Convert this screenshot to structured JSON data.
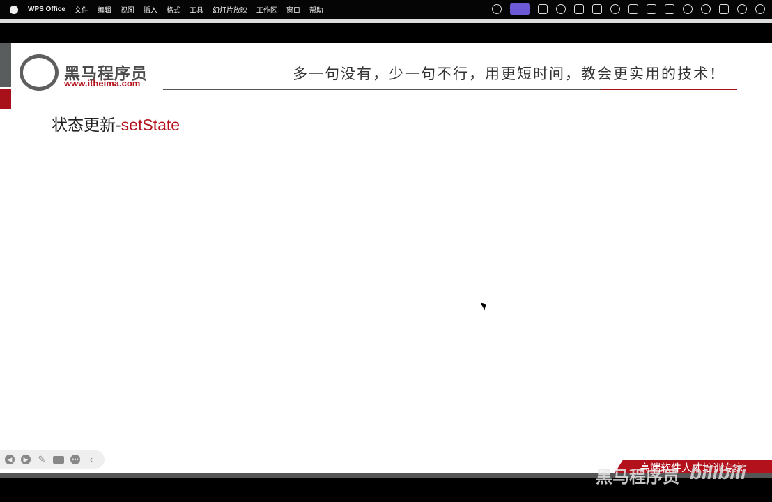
{
  "menubar": {
    "app": "WPS Office",
    "items": [
      "文件",
      "编辑",
      "视图",
      "插入",
      "格式",
      "工具",
      "幻灯片放映",
      "工作区",
      "窗口",
      "帮助"
    ]
  },
  "slide": {
    "brand": "黑马程序员",
    "brand_url": "www.itheima.com",
    "slogan": "多一句没有，少一句不行，用更短时间，教会更实用的技术！",
    "title_prefix": "状态更新-",
    "title_highlight": "setState",
    "footer": "高端软件人才培训专家"
  },
  "watermark": {
    "text": "黑马程序员",
    "logo": "bilibili"
  },
  "colors": {
    "accent": "#b3121d",
    "menubar": "#050505"
  }
}
